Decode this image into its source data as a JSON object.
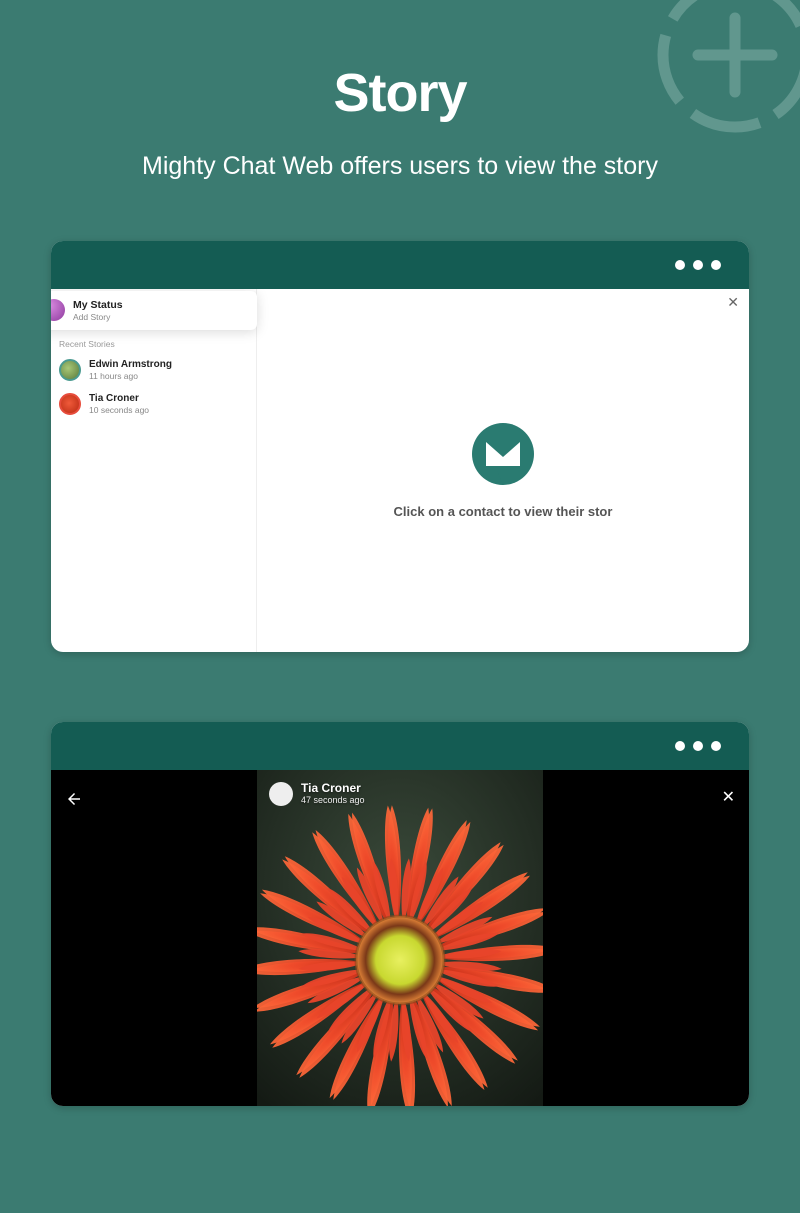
{
  "page": {
    "title": "Story",
    "subtitle": "Mighty Chat Web offers users to view the story"
  },
  "card1": {
    "myStatus": {
      "name": "My Status",
      "sub": "Add Story"
    },
    "sectionLabel": "Recent Stories",
    "stories": [
      {
        "name": "Edwin Armstrong",
        "time": "11 hours ago"
      },
      {
        "name": "Tia Croner",
        "time": "10 seconds ago"
      }
    ],
    "hint": "Click on a contact to view their stor"
  },
  "card2": {
    "viewer": {
      "name": "Tia Croner",
      "time": "47 seconds ago"
    }
  }
}
